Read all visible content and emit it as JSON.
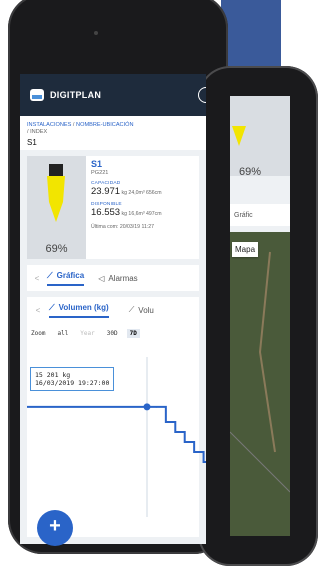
{
  "app": {
    "name": "DIGITPLAN"
  },
  "breadcrumb": {
    "path1": "INSTALACIONES",
    "sep": "/",
    "path2": "NOMBRE-UBICACIÓN",
    "path3": "/ INDEX",
    "current": "S1"
  },
  "device": {
    "name": "S1",
    "code": "PG221",
    "percent": "69%",
    "capacity_label": "CAPACIDAD",
    "capacity_value": "23.971",
    "capacity_detail": "kg 24,0m³ 656cm",
    "available_label": "DISPONIBLE",
    "available_value": "16.553",
    "available_detail": "kg 16,6m³ 497cm",
    "last_update": "Última com: 20/03/19 11:27"
  },
  "tabs": {
    "prev": "<",
    "grafica": "Gráfica",
    "alarmas": "Alarmas"
  },
  "chart_tabs": {
    "prev": "<",
    "volumen": "Volumen (kg)",
    "second": "Volu"
  },
  "zoom": {
    "label": "Zoom",
    "all": "all",
    "year": "Year",
    "d30": "30D",
    "d7": "7D"
  },
  "tooltip": {
    "value": "15 201 kg",
    "date": "16/03/2019 19:27:00"
  },
  "chart_data": {
    "type": "line",
    "series": [
      {
        "values": [
          15201,
          15201,
          15050,
          14950,
          14850,
          14750,
          14650,
          14600
        ]
      }
    ],
    "highlight_index": 0
  },
  "phone2": {
    "percent": "69%",
    "tab": "Gráfic",
    "map_label": "Mapa"
  },
  "fab": {
    "label": "+"
  },
  "colors": {
    "accent": "#2a64c8",
    "appbar": "#1e2b3c",
    "tank": "#f2e500"
  },
  "icons": {
    "logo": "digitplan-logo-icon",
    "chart": "chart-line-icon",
    "alarm": "bell-icon"
  }
}
